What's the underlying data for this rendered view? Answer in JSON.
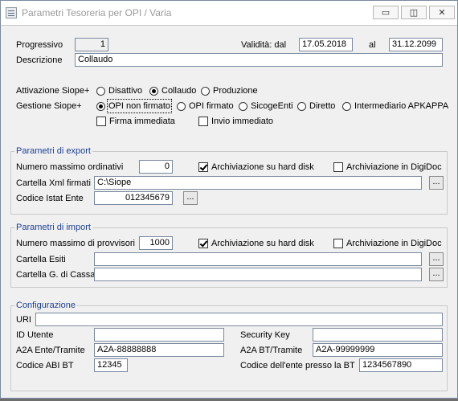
{
  "window": {
    "title": "Parametri Tesoreria per OPI / Varia",
    "minimize_glyph": "▭",
    "restore_glyph": "◫",
    "close_glyph": "✕"
  },
  "header": {
    "progressivo_label": "Progressivo",
    "progressivo_value": "1",
    "validita_label": "Validità: dal",
    "validita_dal": "17.05.2018",
    "al_label": "al",
    "validita_al": "31.12.2099",
    "descrizione_label": "Descrizione",
    "descrizione_value": "Collaudo"
  },
  "siope": {
    "attivazione_label": "Attivazione Siope+",
    "attivazione_options": [
      {
        "label": "Disattivo",
        "selected": false
      },
      {
        "label": "Collaudo",
        "selected": true
      },
      {
        "label": "Produzione",
        "selected": false
      }
    ],
    "gestione_label": "Gestione Siope+",
    "gestione_options": [
      {
        "label": "OPI non firmato",
        "selected": true
      },
      {
        "label": "OPI firmato",
        "selected": false
      },
      {
        "label": "SicogeEnti",
        "selected": false
      },
      {
        "label": "Diretto",
        "selected": false
      },
      {
        "label": "Intermediario APKAPPA",
        "selected": false
      }
    ],
    "firma_immediata_label": "Firma immediata",
    "firma_immediata_checked": false,
    "invio_immediato_label": "Invio immediato",
    "invio_immediato_checked": false
  },
  "export": {
    "title": "Parametri di export",
    "numero_label": "Numero massimo ordinativi",
    "numero_value": "0",
    "archiviazione_disk_label": "Archiviazione su hard disk",
    "archiviazione_disk_checked": true,
    "archiviazione_digidoc_label": "Archiviazione in DigiDoc",
    "archiviazione_digidoc_checked": false,
    "cartella_label": "Cartella Xml firmati",
    "cartella_value": "C:\\Siope",
    "codice_istat_label": "Codice Istat Ente",
    "codice_istat_value": "012345679",
    "browse_label": "..."
  },
  "import": {
    "title": "Parametri di import",
    "numero_label": "Numero massimo di provvisori",
    "numero_value": "1000",
    "archiviazione_disk_label": "Archiviazione su hard disk",
    "archiviazione_disk_checked": true,
    "archiviazione_digidoc_label": "Archiviazione in DigiDoc",
    "archiviazione_digidoc_checked": false,
    "cartella_esiti_label": "Cartella Esiti",
    "cartella_esiti_value": "",
    "cartella_cassa_label": "Cartella G. di Cassa",
    "cartella_cassa_value": "",
    "browse_label": "..."
  },
  "config": {
    "title": "Configurazione",
    "uri_label": "URI",
    "uri_value": "",
    "id_utente_label": "ID Utente",
    "id_utente_value": "",
    "security_key_label": "Security Key",
    "security_key_value": "",
    "a2a_ente_label": "A2A Ente/Tramite",
    "a2a_ente_value": "A2A-88888888",
    "a2a_bt_label": "A2A BT/Tramite",
    "a2a_bt_value": "A2A-99999999",
    "codice_abi_label": "Codice ABI BT",
    "codice_abi_value": "12345",
    "codice_ente_bt_label": "Codice dell'ente presso la BT",
    "codice_ente_bt_value": "1234567890"
  }
}
